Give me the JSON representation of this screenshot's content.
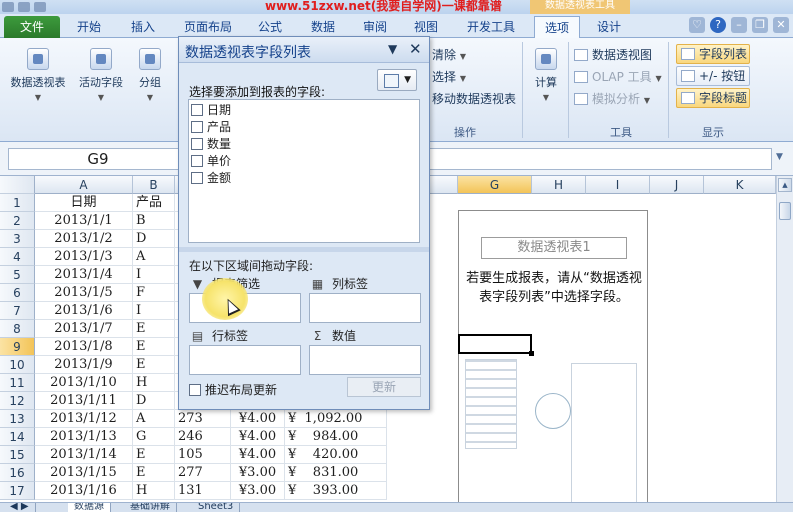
{
  "title_bar": {
    "watermark_url": "www.51zxw.net(我要自学网)一课都靠谱",
    "context_tool_label": "数据透视表工具"
  },
  "tabs": [
    {
      "label": "文件"
    },
    {
      "label": "开始"
    },
    {
      "label": "插入"
    },
    {
      "label": "页面布局"
    },
    {
      "label": "公式"
    },
    {
      "label": "数据"
    },
    {
      "label": "审阅"
    },
    {
      "label": "视图"
    },
    {
      "label": "开发工具"
    },
    {
      "label": "选项"
    },
    {
      "label": "设计"
    }
  ],
  "window_controls": [
    "♡",
    "?",
    "–",
    "❐",
    "✕"
  ],
  "ribbon": {
    "pivot_table_btn": "数据透视表",
    "active_field_btn": "活动字段",
    "group_btn": "分组",
    "clear_btn": "清除",
    "select_btn": "选择",
    "move_pivot_btn": "移动数据透视表",
    "ops_group_label": "操作",
    "calc_btn": "计算",
    "pivot_chart_btn": "数据透视图",
    "olap_btn": "OLAP 工具",
    "whatif_btn": "模拟分析",
    "tools_group_label": "工具",
    "field_list_btn": "字段列表",
    "plus_minus_btn": "+/- 按钮",
    "field_headers_btn": "字段标题",
    "show_group_label": "显示"
  },
  "namebox": "G9",
  "columns": [
    "A",
    "B",
    "G",
    "H",
    "I",
    "J",
    "K"
  ],
  "rows": [
    {
      "num": "1",
      "date": "日期",
      "product": "产品",
      "qty": "",
      "price": "",
      "amount": ""
    },
    {
      "num": "2",
      "date": "2013/1/1",
      "product": "B",
      "qty": "",
      "price": "",
      "amount": ""
    },
    {
      "num": "3",
      "date": "2013/1/2",
      "product": "D",
      "qty": "",
      "price": "",
      "amount": ""
    },
    {
      "num": "4",
      "date": "2013/1/3",
      "product": "A",
      "qty": "",
      "price": "",
      "amount": ""
    },
    {
      "num": "5",
      "date": "2013/1/4",
      "product": "I",
      "qty": "",
      "price": "",
      "amount": ""
    },
    {
      "num": "6",
      "date": "2013/1/5",
      "product": "F",
      "qty": "",
      "price": "",
      "amount": ""
    },
    {
      "num": "7",
      "date": "2013/1/6",
      "product": "I",
      "qty": "",
      "price": "",
      "amount": ""
    },
    {
      "num": "8",
      "date": "2013/1/7",
      "product": "E",
      "qty": "",
      "price": "",
      "amount": ""
    },
    {
      "num": "9",
      "date": "2013/1/8",
      "product": "E",
      "qty": "",
      "price": "",
      "amount": ""
    },
    {
      "num": "10",
      "date": "2013/1/9",
      "product": "E",
      "qty": "",
      "price": "",
      "amount": ""
    },
    {
      "num": "11",
      "date": "2013/1/10",
      "product": "H",
      "qty": "",
      "price": "",
      "amount": ""
    },
    {
      "num": "12",
      "date": "2013/1/11",
      "product": "D",
      "qty": "",
      "price": "",
      "amount": ""
    },
    {
      "num": "13",
      "date": "2013/1/12",
      "product": "A",
      "qty": "273",
      "price": "¥4.00",
      "amount": "¥  1,092.00"
    },
    {
      "num": "14",
      "date": "2013/1/13",
      "product": "G",
      "qty": "246",
      "price": "¥4.00",
      "amount": "¥    984.00"
    },
    {
      "num": "15",
      "date": "2013/1/14",
      "product": "E",
      "qty": "105",
      "price": "¥4.00",
      "amount": "¥    420.00"
    },
    {
      "num": "16",
      "date": "2013/1/15",
      "product": "E",
      "qty": "277",
      "price": "¥3.00",
      "amount": "¥    831.00"
    },
    {
      "num": "17",
      "date": "2013/1/16",
      "product": "H",
      "qty": "131",
      "price": "¥3.00",
      "amount": "¥    393.00"
    }
  ],
  "pivot_placeholder": {
    "title": "数据透视表1",
    "instruction": "若要生成报表，请从“数据透视表字段列表”中选择字段。"
  },
  "field_pane": {
    "title": "数据透视表字段列表",
    "prompt": "选择要添加到报表的字段:",
    "fields": [
      {
        "label": "日期",
        "checked": false
      },
      {
        "label": "产品",
        "checked": false
      },
      {
        "label": "数量",
        "checked": false
      },
      {
        "label": "单价",
        "checked": false
      },
      {
        "label": "金额",
        "checked": false
      }
    ],
    "drag_label": "在以下区域间拖动字段:",
    "report_filter": "报表筛选",
    "column_labels": "列标签",
    "row_labels": "行标签",
    "values": "数值",
    "defer_update": "推迟布局更新",
    "update_btn": "更新"
  },
  "sheet_tabs": [
    "数据源",
    "基础讲解",
    "Sheet3"
  ]
}
